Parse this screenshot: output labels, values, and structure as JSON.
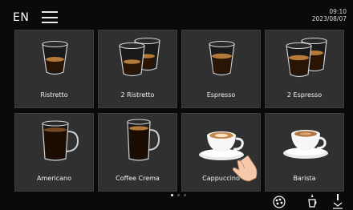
{
  "header": {
    "language": "EN",
    "menu_icon": "hamburger-icon",
    "time": "09:10",
    "date": "2023/08/07"
  },
  "drinks": [
    {
      "label": "Ristretto",
      "icon": "glass-cup-single-small"
    },
    {
      "label": "2 Ristretto",
      "icon": "glass-cup-double-small"
    },
    {
      "label": "Espresso",
      "icon": "glass-cup-single"
    },
    {
      "label": "2 Espresso",
      "icon": "glass-cup-double"
    },
    {
      "label": "Americano",
      "icon": "glass-mug"
    },
    {
      "label": "Coffee Crema",
      "icon": "tall-glass-mug"
    },
    {
      "label": "Cappuccino",
      "icon": "cappuccino-cup"
    },
    {
      "label": "Barista",
      "icon": "barista-cup"
    }
  ],
  "pagination": {
    "pages": 3,
    "current": 1
  },
  "footer_icons": [
    "bean-selection-icon",
    "milk-drop-icon",
    "rinse-icon"
  ]
}
